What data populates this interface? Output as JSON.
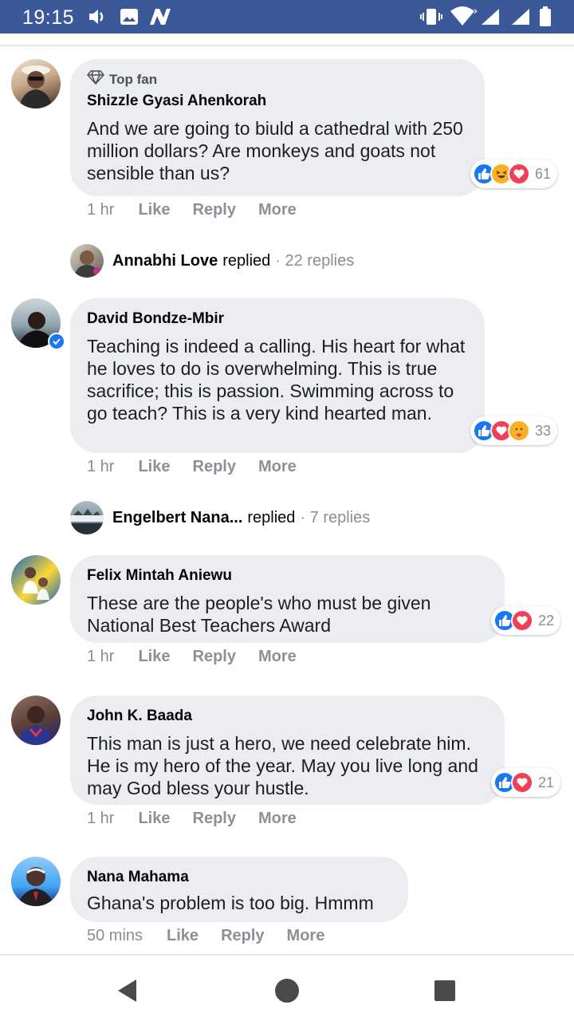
{
  "status_bar": {
    "time": "19:15",
    "icons": [
      "volume-icon",
      "image-icon",
      "n-logo-icon",
      "vibrate-icon",
      "wifi-icon",
      "signal-icon",
      "signal-icon-2",
      "battery-icon"
    ]
  },
  "colors": {
    "status_bar_bg": "#3b5998",
    "bubble_bg": "#ebedf0",
    "like_blue": "#1877f2",
    "love_red": "#f33e58",
    "haha_yellow": "#f7b125",
    "meta_gray": "#8a8d91"
  },
  "comments": [
    {
      "badge": "Top fan",
      "author": "Shizzle Gyasi Ahenkorah",
      "text": "And we are going to biuld a cathedral with 250 million dollars? Are monkeys and goats not sensible than us?",
      "time": "1 hr",
      "like": "Like",
      "reply": "Reply",
      "more": "More",
      "reactions": [
        "like",
        "haha",
        "love"
      ],
      "reaction_count": "61"
    },
    {
      "author": "David Bondze-Mbir",
      "text": "Teaching is indeed a calling. His heart for what he loves to do is overwhelming. This is true sacrifice; this is passion. Swimming across to go teach? This is a very kind hearted man.",
      "time": "1 hr",
      "like": "Like",
      "reply": "Reply",
      "more": "More",
      "reactions": [
        "like",
        "love",
        "care"
      ],
      "reaction_count": "33"
    },
    {
      "author": "Felix Mintah Aniewu",
      "text": "These are the people's who must be given National Best Teachers Award",
      "time": "1 hr",
      "like": "Like",
      "reply": "Reply",
      "more": "More",
      "reactions": [
        "like",
        "love"
      ],
      "reaction_count": "22"
    },
    {
      "author": "John K. Baada",
      "text": "This man is just a hero, we need celebrate him. He is my hero of the year. May you live long and may God bless your hustle.",
      "time": "1 hr",
      "like": "Like",
      "reply": "Reply",
      "more": "More",
      "reactions": [
        "like",
        "love"
      ],
      "reaction_count": "21"
    },
    {
      "author": "Nana Mahama",
      "text": "Ghana's problem is too big. Hmmm",
      "time": "50 mins",
      "like": "Like",
      "reply": "Reply",
      "more": "More"
    }
  ],
  "replies": [
    {
      "name": "Annabhi Love",
      "verb": "replied",
      "count": "· 22 replies"
    },
    {
      "name": "Engelbert Nana...",
      "verb": "replied",
      "count": "· 7 replies"
    }
  ],
  "nav": [
    "back-icon",
    "home-icon",
    "recents-icon"
  ]
}
